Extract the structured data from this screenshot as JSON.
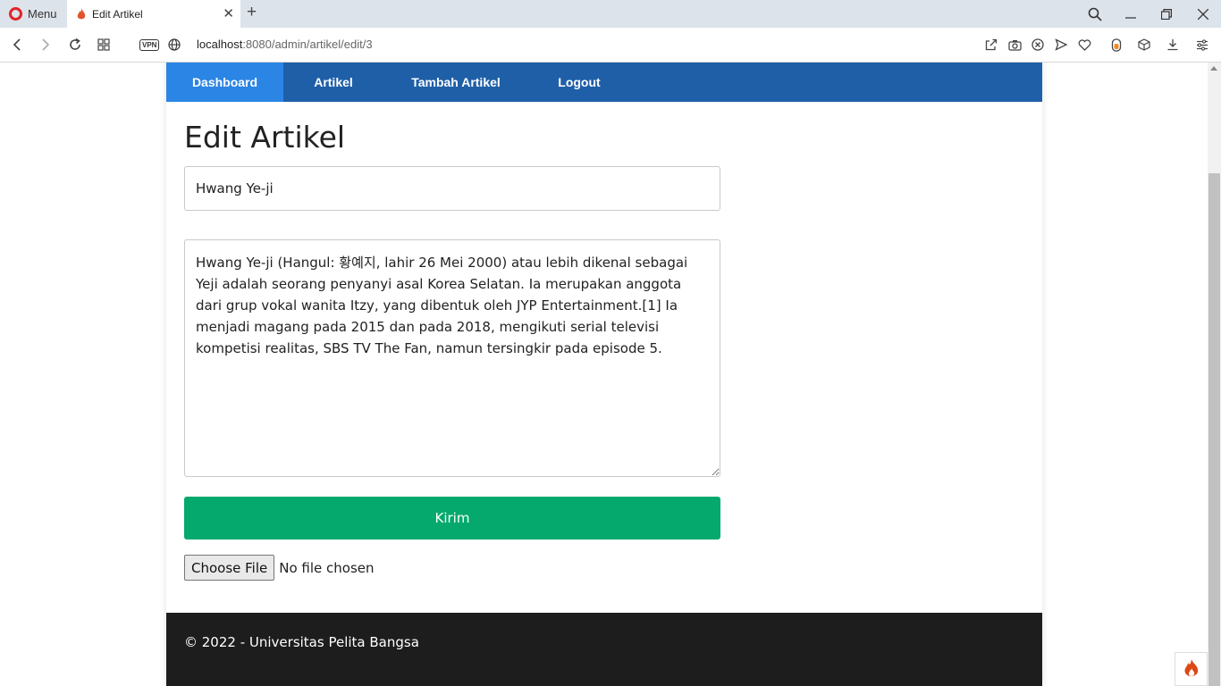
{
  "browser": {
    "menu_label": "Menu",
    "tab_title": "Edit Artikel",
    "url_host": "localhost",
    "url_rest": ":8080/admin/artikel/edit/3",
    "vpn_label": "VPN"
  },
  "nav": {
    "items": [
      {
        "label": "Dashboard",
        "active": true
      },
      {
        "label": "Artikel",
        "active": false
      },
      {
        "label": "Tambah Artikel",
        "active": false
      },
      {
        "label": "Logout",
        "active": false
      }
    ]
  },
  "page": {
    "heading": "Edit Artikel",
    "title_value": "Hwang Ye-ji",
    "content_value": "Hwang Ye-ji (Hangul: 황예지, lahir 26 Mei 2000) atau lebih dikenal sebagai Yeji adalah seorang penyanyi asal Korea Selatan. Ia merupakan anggota dari grup vokal wanita Itzy, yang dibentuk oleh JYP Entertainment.[1] Ia menjadi magang pada 2015 dan pada 2018, mengikuti serial televisi kompetisi realitas, SBS TV The Fan, namun tersingkir pada episode 5.",
    "submit_label": "Kirim",
    "file_button_label": "Choose File",
    "file_status": "No file chosen"
  },
  "footer": {
    "text": "© 2022 - Universitas Pelita Bangsa"
  },
  "colors": {
    "navbar": "#1f5fa8",
    "nav_active": "#2b85e4",
    "submit": "#05a96d",
    "footer": "#1d1d1d"
  }
}
